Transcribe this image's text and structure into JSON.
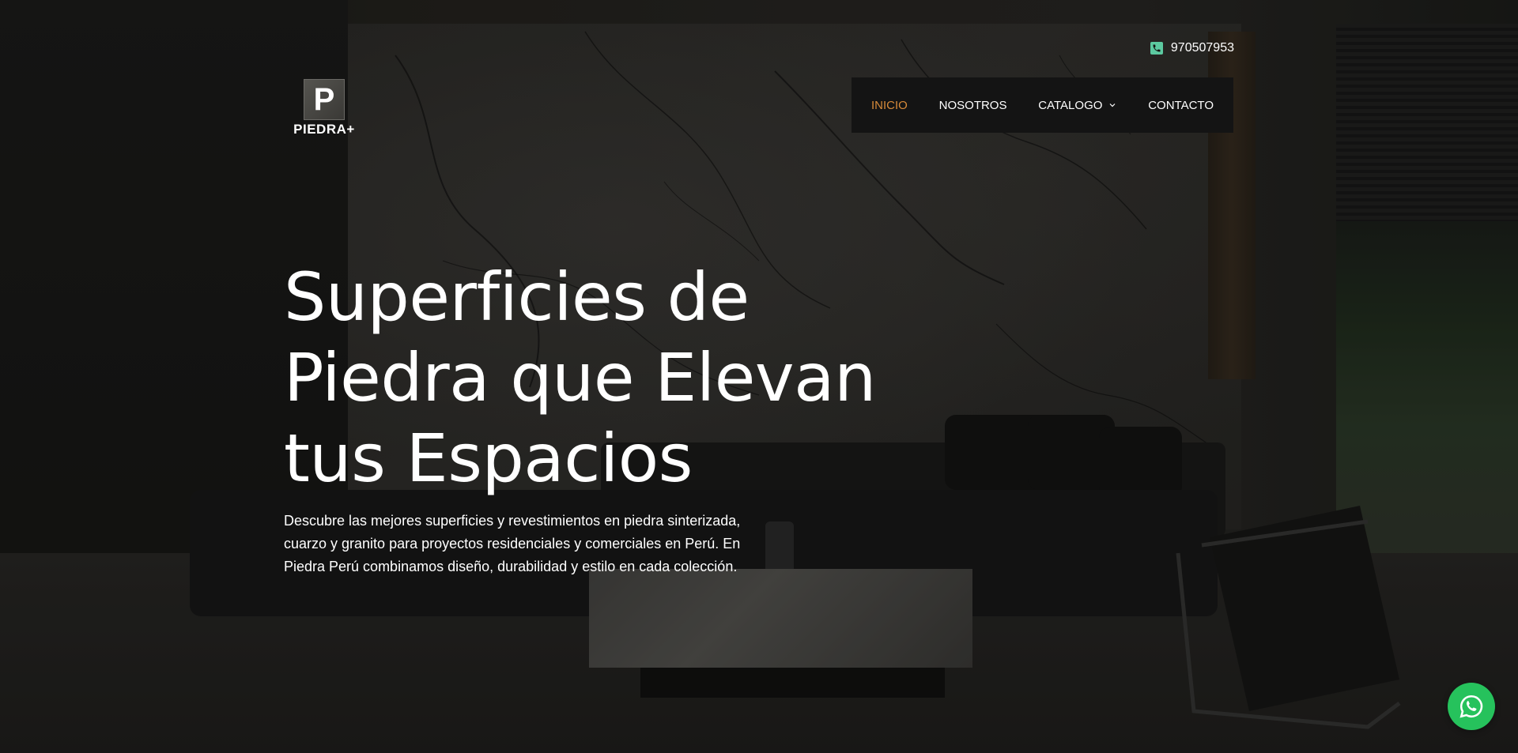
{
  "header": {
    "phone": "970507953",
    "phone_icon": "phone-icon",
    "logo": {
      "mark": "P",
      "wordmark": "PIEDRA+"
    }
  },
  "nav": {
    "items": [
      {
        "label": "INICIO",
        "active": true
      },
      {
        "label": "NOSOTROS",
        "active": false
      },
      {
        "label": "CATALOGO",
        "active": false,
        "has_dropdown": true
      },
      {
        "label": "CONTACTO",
        "active": false
      }
    ],
    "active_color": "#d68a39"
  },
  "hero": {
    "headline": "Superficies de Piedra que Elevan tus Espacios",
    "description": "Descubre las mejores superficies y revestimientos en piedra sinterizada, cuarzo y granito para proyectos residenciales y comerciales en Perú. En Piedra Perú combinamos diseño, durabilidad y estilo en cada colección."
  },
  "floating": {
    "whatsapp_icon": "whatsapp-icon",
    "whatsapp_color": "#26c25c"
  }
}
